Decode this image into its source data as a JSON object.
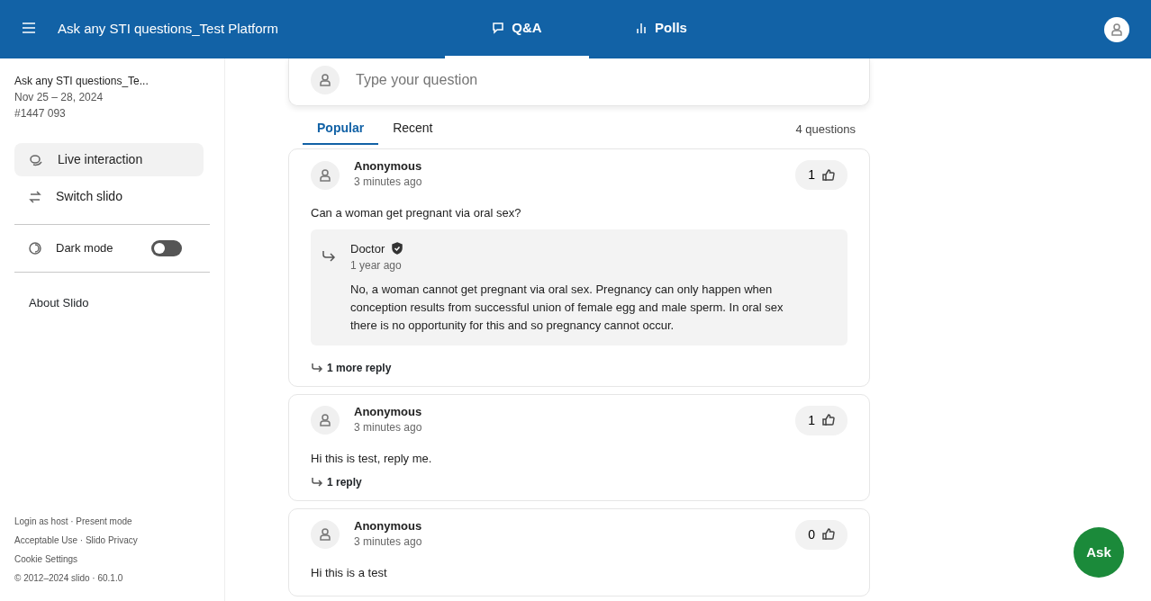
{
  "header": {
    "title": "Ask any STI questions_Test Platform",
    "tabs": [
      {
        "label": "Q&A",
        "kind": "qa",
        "selected": true
      },
      {
        "label": "Polls",
        "kind": "polls",
        "selected": false
      }
    ]
  },
  "sidebar": {
    "event_name": "Ask any STI questions_Te...",
    "dates": "Nov 25 – 28, 2024",
    "code": "#1447 093",
    "items": [
      {
        "label": "Live interaction",
        "kind": "chat",
        "selected": true
      },
      {
        "label": "Switch slido",
        "kind": "switch",
        "selected": false
      }
    ],
    "dark_mode": {
      "label": "Dark mode",
      "on": false
    },
    "about": "About Slido",
    "footer": [
      "Login as host · Present mode",
      "Acceptable Use · Slido Privacy",
      "Cookie Settings",
      "© 2012–2024 slido · 60.1.0"
    ]
  },
  "question_input": {
    "placeholder": "Type your question"
  },
  "sort_tabs": [
    {
      "label": "Popular",
      "selected": true
    },
    {
      "label": "Recent",
      "selected": false
    }
  ],
  "question_count": "4 questions",
  "questions": [
    {
      "author": "Anonymous",
      "time": "3 minutes ago",
      "votes": "1",
      "text": "Can a woman get pregnant via oral sex?",
      "reply": {
        "author": "Doctor",
        "verified": true,
        "time": "1 year ago",
        "text": "No, a woman cannot get pregnant via oral sex. Pregnancy can only happen when conception results from successful union of female egg and male sperm. In oral sex there is no opportunity for this and so pregnancy cannot occur."
      },
      "replies_link": "1 more reply"
    },
    {
      "author": "Anonymous",
      "time": "3 minutes ago",
      "votes": "1",
      "text": "Hi this is test, reply me.",
      "replies_link": "1 reply"
    },
    {
      "author": "Anonymous",
      "time": "3 minutes ago",
      "votes": "0",
      "text": "Hi this is a test"
    }
  ],
  "ask_button": "Ask"
}
